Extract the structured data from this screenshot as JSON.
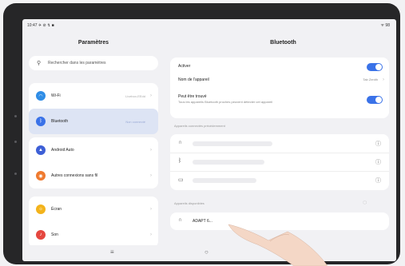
{
  "status_bar": {
    "time": "10:47 ✈ ⊘ ↯ ■",
    "right": "ᯤ 98"
  },
  "left": {
    "title": "Paramètres",
    "search_placeholder": "Rechercher dans les paramètres",
    "group1": [
      {
        "label": "Wi-Fi",
        "value": "Livebox-EEdd",
        "icon": "wifi-icon",
        "color": "#2f8de6"
      },
      {
        "label": "Bluetooth",
        "value": "Non connecté",
        "icon": "bluetooth-icon",
        "color": "#3a72e8",
        "selected": true
      }
    ],
    "group2": [
      {
        "label": "Android Auto",
        "icon": "android-auto-icon",
        "color": "#3d5fd6"
      },
      {
        "label": "Autres connexions sans fil",
        "icon": "connections-icon",
        "color": "#ef7a2f"
      }
    ],
    "group3": [
      {
        "label": "Écran",
        "icon": "display-icon",
        "color": "#f3b31b"
      },
      {
        "label": "Son",
        "icon": "sound-icon",
        "color": "#e5473f"
      }
    ]
  },
  "right": {
    "title": "Bluetooth",
    "activate_label": "Activer",
    "activate_on": true,
    "device_name_label": "Nom de l'appareil",
    "device_name_value": "Tab Zenith",
    "discoverable_label": "Peut être trouvé",
    "discoverable_sub": "Tous les appareils Bluetooth proches peuvent détecter cet appareil",
    "discoverable_on": true,
    "paired_section": "Appareils connectés précédemment",
    "paired_devices": [
      {
        "icon": "headphones-icon"
      },
      {
        "icon": "bluetooth-icon"
      },
      {
        "icon": "laptop-icon"
      }
    ],
    "available_section": "Appareils disponibles",
    "available_devices": [
      {
        "label": "ADAPT 6...",
        "icon": "headphones-icon"
      }
    ]
  },
  "navbar": {
    "menu": "≡",
    "home": "○",
    "back": "‹"
  }
}
